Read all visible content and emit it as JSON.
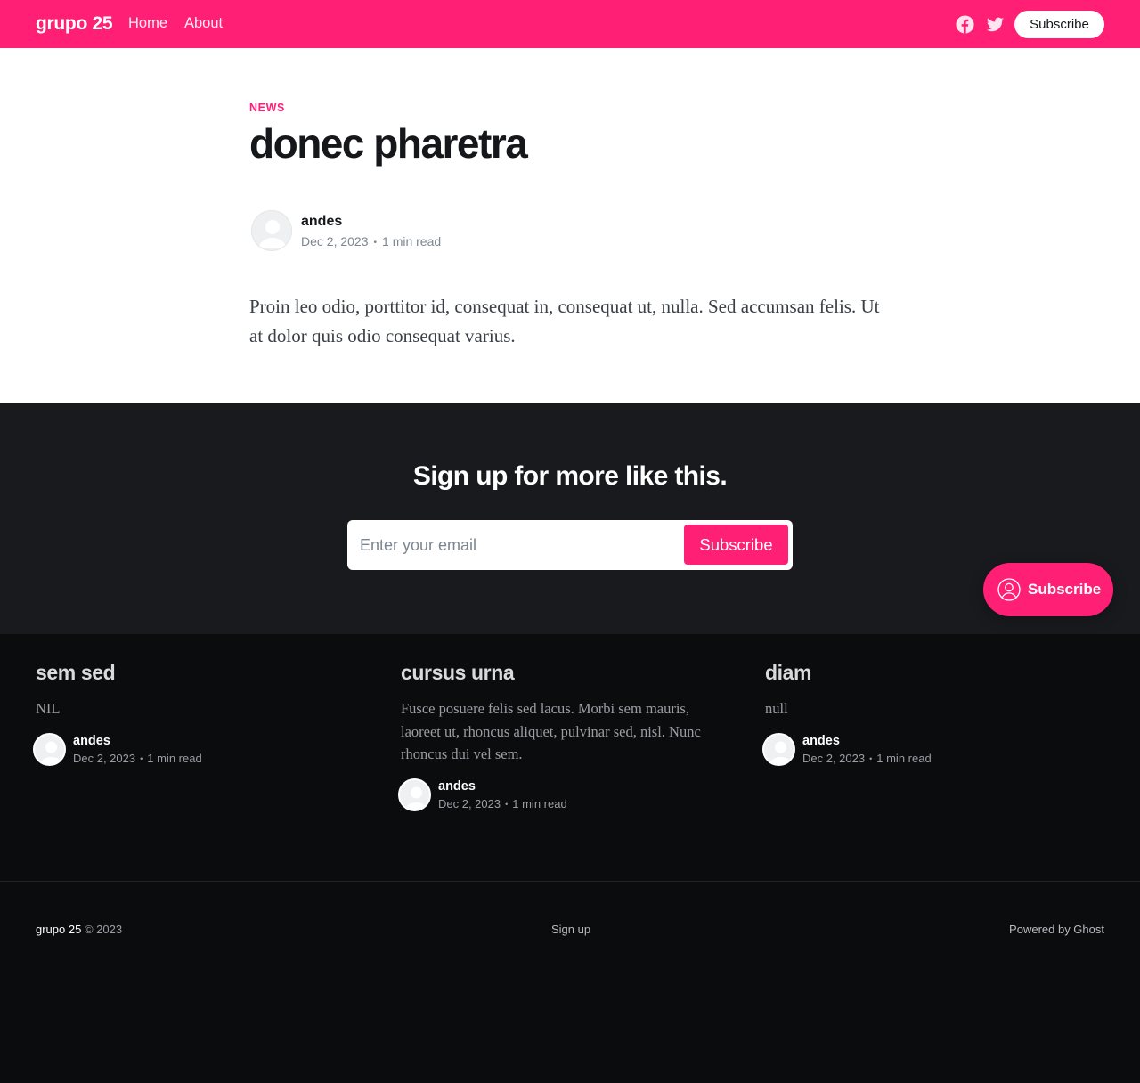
{
  "header": {
    "logo": "grupo 25",
    "nav": [
      "Home",
      "About"
    ],
    "subscribe_label": "Subscribe",
    "icons": [
      "facebook-icon",
      "twitter-icon"
    ],
    "accent_color": "#ff1f75"
  },
  "article": {
    "tag": "NEWS",
    "title": "donec pharetra",
    "author": "andes",
    "date": "Dec 2, 2023",
    "read_time": "1 min read",
    "excerpt": "Proin leo odio, porttitor id, consequat in, consequat ut, nulla. Sed accumsan felis. Ut at dolor quis odio consequat varius."
  },
  "signup": {
    "title": "Sign up for more like this.",
    "email_placeholder": "Enter your email",
    "button_label": "Subscribe",
    "floating_label": "Subscribe"
  },
  "related": [
    {
      "title": "sem sed",
      "excerpt": "NIL",
      "author": "andes",
      "date": "Dec 2, 2023",
      "read_time": "1 min read"
    },
    {
      "title": "cursus urna",
      "excerpt": "Fusce posuere felis sed lacus. Morbi sem mauris, laoreet ut, rhoncus aliquet, pulvinar sed, nisl. Nunc rhoncus dui vel sem.",
      "author": "andes",
      "date": "Dec 2, 2023",
      "read_time": "1 min read"
    },
    {
      "title": "diam",
      "excerpt": "null",
      "author": "andes",
      "date": "Dec 2, 2023",
      "read_time": "1 min read"
    }
  ],
  "footer": {
    "site_name": "grupo 25",
    "copyright": "© 2023",
    "signup_link": "Sign up",
    "powered_by": "Powered by Ghost"
  }
}
